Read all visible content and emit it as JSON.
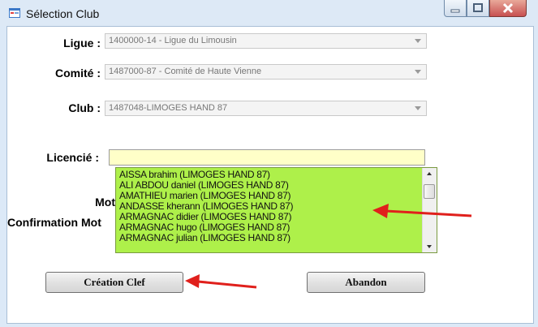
{
  "window": {
    "title": "Sélection Club",
    "icon": "form-icon",
    "controls": [
      "minimize-icon",
      "maximize-icon",
      "close-icon"
    ]
  },
  "form": {
    "ligue": {
      "label": "Ligue :",
      "value": "1400000-14 - Ligue du Limousin"
    },
    "comite": {
      "label": "Comité :",
      "value": "1487000-87 - Comité de Haute Vienne"
    },
    "club": {
      "label": "Club :",
      "value": "1487048-LIMOGES HAND 87"
    },
    "licencie": {
      "label": "Licencié :",
      "value": ""
    },
    "mot_label": "Mot",
    "confirmation_label": "Confirmation Mot"
  },
  "list": {
    "items": [
      "AISSA brahim (LIMOGES HAND 87)",
      "ALI ABDOU daniel (LIMOGES HAND 87)",
      "AMATHIEU marien (LIMOGES HAND 87)",
      "ANDASSE kherann (LIMOGES HAND 87)",
      "ARMAGNAC didier (LIMOGES HAND 87)",
      "ARMAGNAC hugo (LIMOGES HAND 87)",
      "ARMAGNAC julian (LIMOGES HAND 87)"
    ],
    "highlight_color": "#aef04a"
  },
  "buttons": {
    "create": "Création Clef",
    "cancel": "Abandon"
  },
  "annotations": {
    "arrow_color": "#e0201c"
  }
}
